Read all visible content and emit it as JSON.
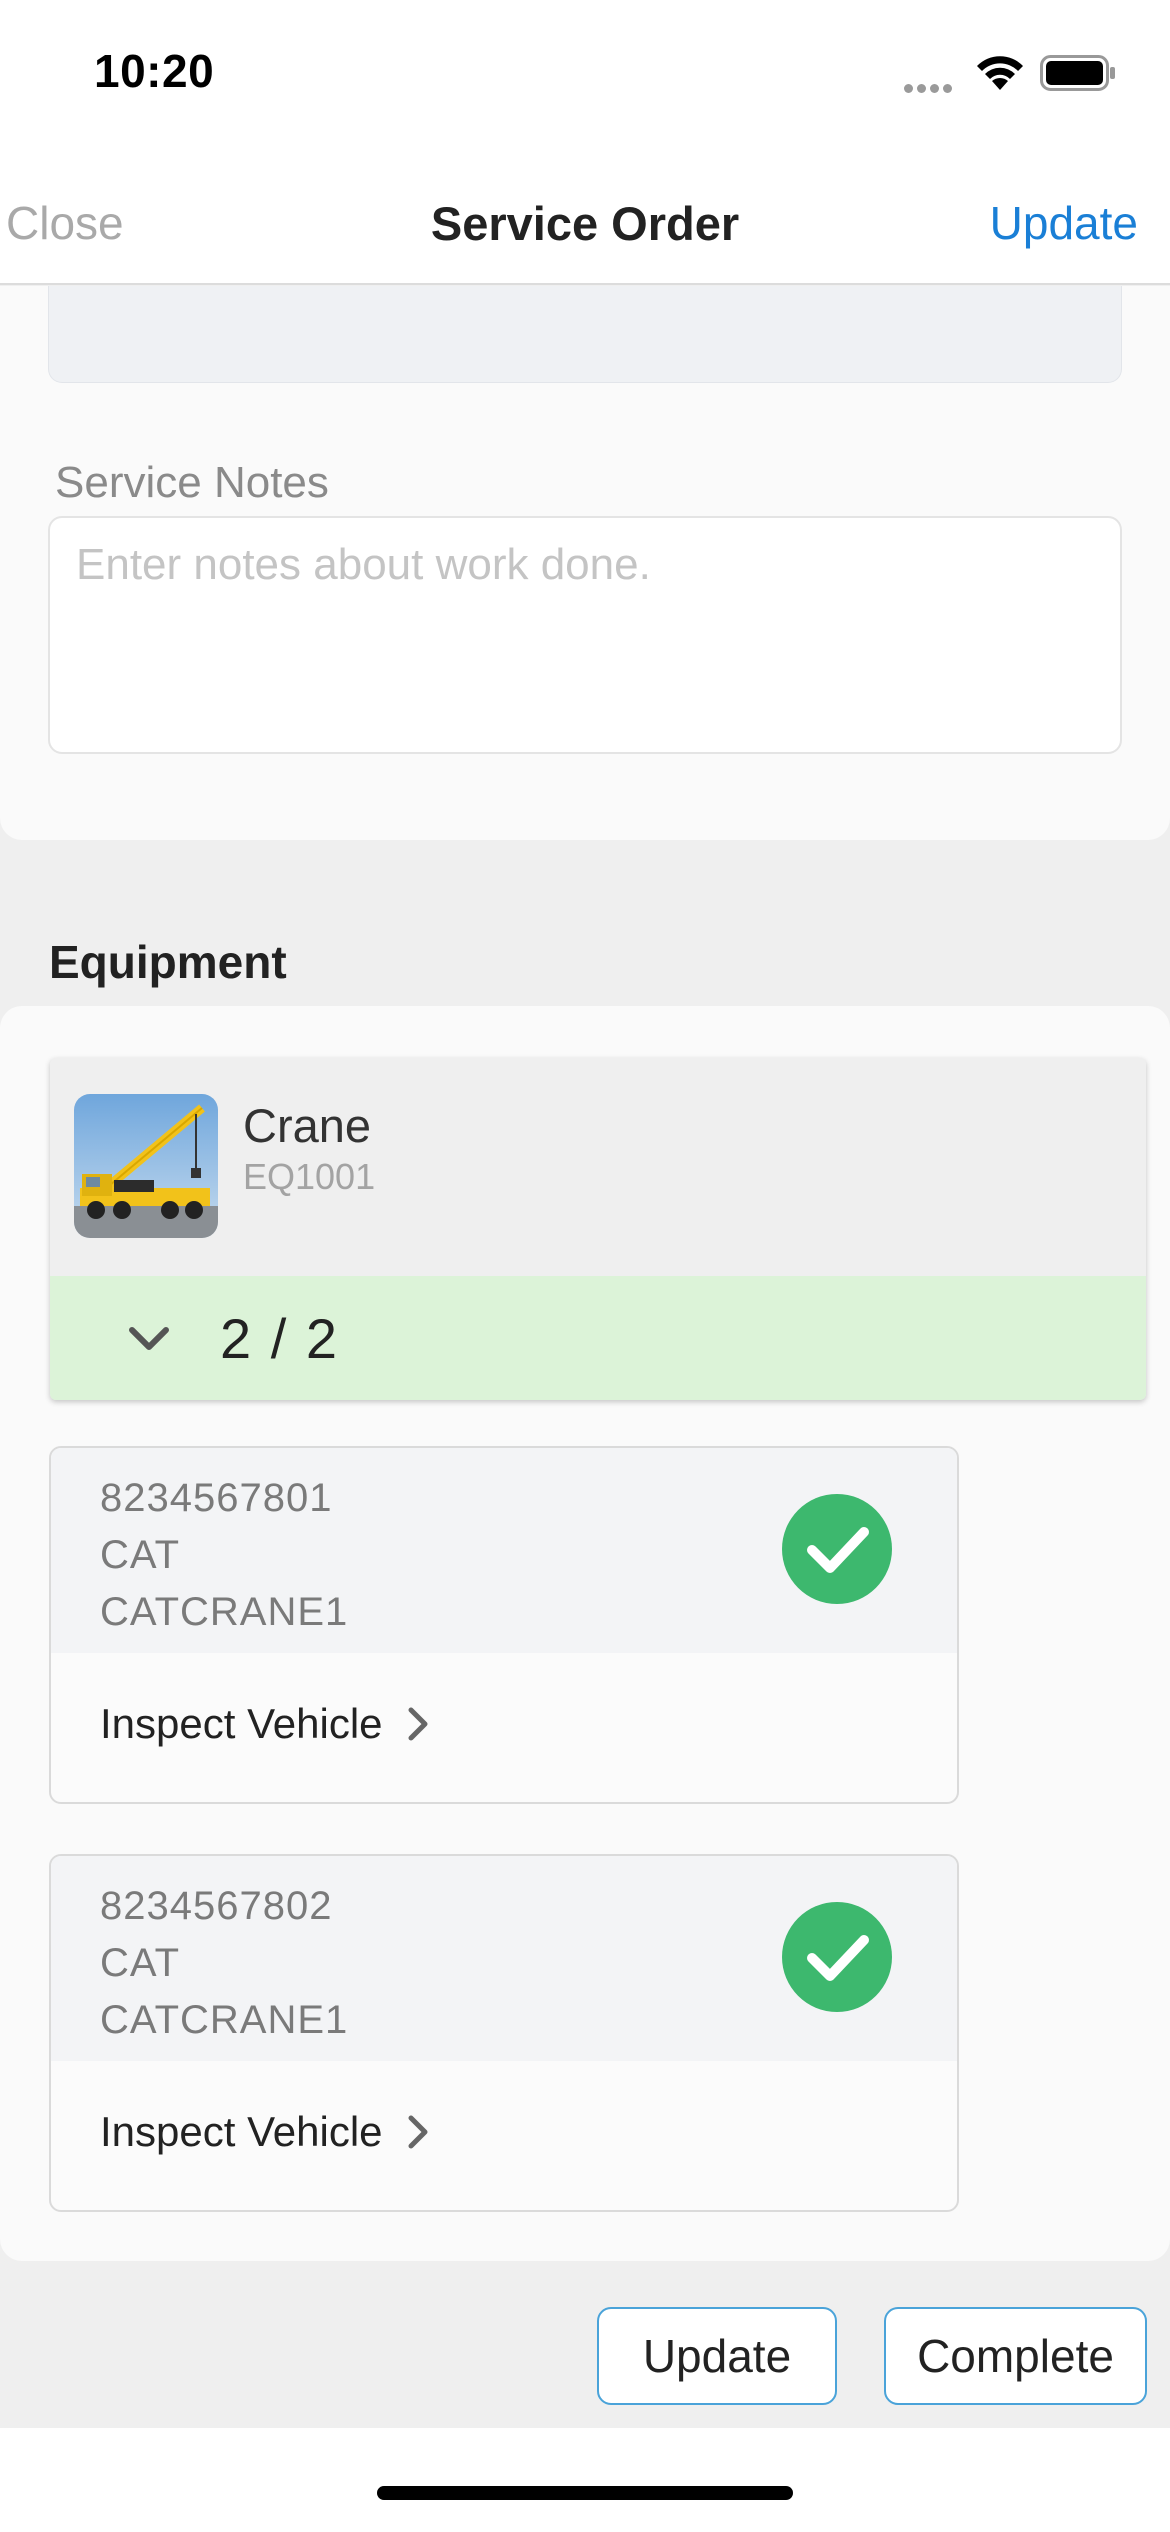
{
  "status_bar": {
    "time": "10:20"
  },
  "nav": {
    "close_label": "Close",
    "title": "Service Order",
    "update_label": "Update"
  },
  "form": {
    "notes_label": "Service Notes",
    "notes_placeholder": "Enter notes about work done.",
    "notes_value": ""
  },
  "equipment": {
    "section_title": "Equipment",
    "name": "Crane",
    "code": "EQ1001",
    "image_icon": "crane-photo",
    "progress": "2 / 2",
    "progress_color": "#dcf3d8",
    "items": [
      {
        "serial": "8234567801",
        "make": "CAT",
        "model": "CATCRANE1",
        "status": "complete",
        "action_label": "Inspect Vehicle"
      },
      {
        "serial": "8234567802",
        "make": "CAT",
        "model": "CATCRANE1",
        "status": "complete",
        "action_label": "Inspect Vehicle"
      }
    ]
  },
  "actions": {
    "update_label": "Update",
    "complete_label": "Complete"
  },
  "colors": {
    "accent": "#1a7fd6",
    "success": "#3db86e",
    "button_border": "#4aa3d9"
  }
}
